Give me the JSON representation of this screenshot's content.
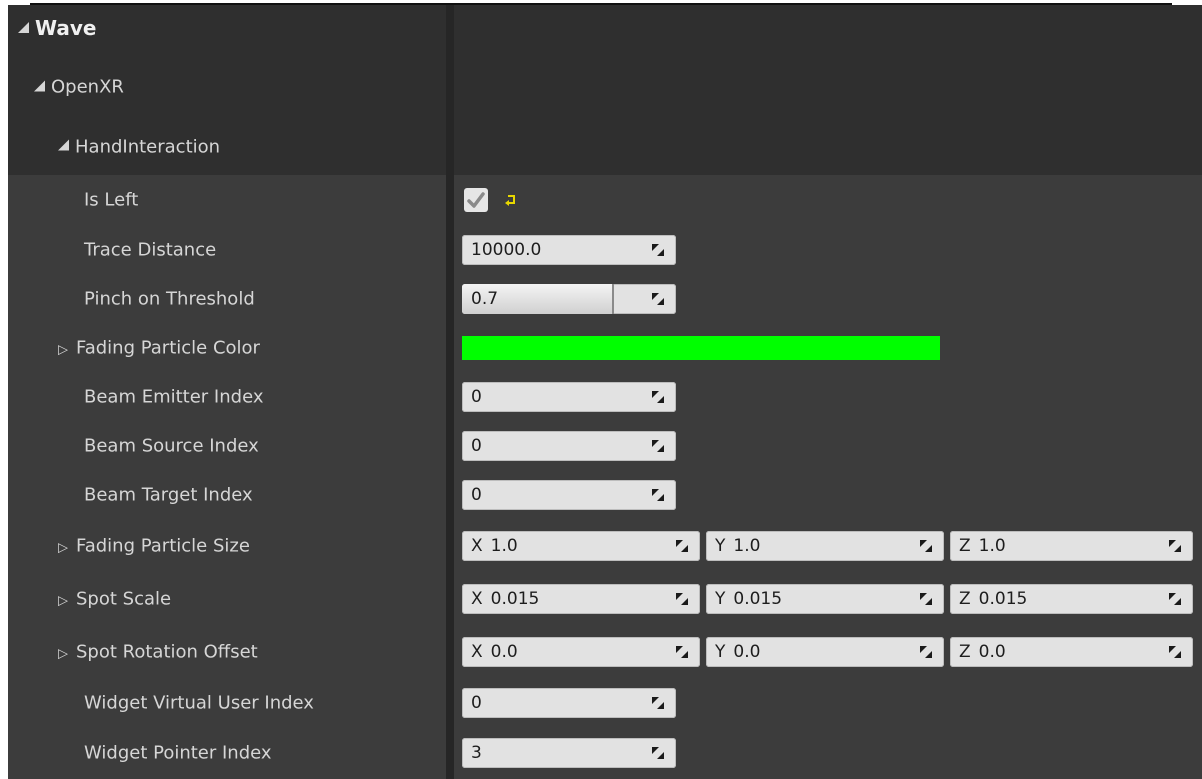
{
  "categories": {
    "wave": "Wave",
    "openxr": "OpenXR",
    "hand_interaction": "HandInteraction"
  },
  "properties": {
    "is_left": {
      "label": "Is Left",
      "checked": true
    },
    "trace_distance": {
      "label": "Trace Distance",
      "value": "10000.0"
    },
    "pinch_on_threshold": {
      "label": "Pinch on Threshold",
      "value": "0.7",
      "slider_fraction": 0.7
    },
    "fading_particle_color": {
      "label": "Fading Particle Color",
      "color": "#00ff00"
    },
    "beam_emitter_index": {
      "label": "Beam Emitter Index",
      "value": "0"
    },
    "beam_source_index": {
      "label": "Beam Source Index",
      "value": "0"
    },
    "beam_target_index": {
      "label": "Beam Target Index",
      "value": "0"
    },
    "fading_particle_size": {
      "label": "Fading Particle Size",
      "x": "1.0",
      "y": "1.0",
      "z": "1.0"
    },
    "spot_scale": {
      "label": "Spot Scale",
      "x": "0.015",
      "y": "0.015",
      "z": "0.015"
    },
    "spot_rotation_offset": {
      "label": "Spot Rotation Offset",
      "x": "0.0",
      "y": "0.0",
      "z": "0.0"
    },
    "widget_virtual_user_index": {
      "label": "Widget Virtual User Index",
      "value": "0"
    },
    "widget_pointer_index": {
      "label": "Widget Pointer Index",
      "value": "3"
    }
  },
  "axis_labels": {
    "x": "X",
    "y": "Y",
    "z": "Z"
  },
  "colors": {
    "panel_bg": "#3c3c3c",
    "category_bg": "#2f2f2f",
    "field_bg": "#e2e2e2",
    "reset_arrow": "#e8d700"
  }
}
